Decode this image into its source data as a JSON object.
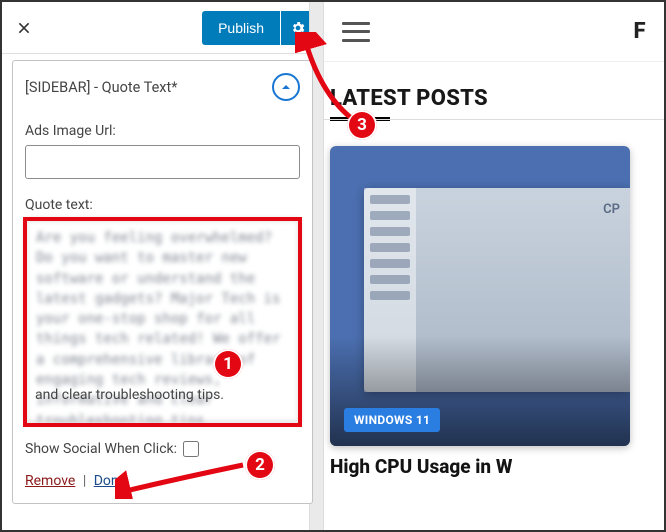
{
  "topbar": {
    "publish_label": "Publish"
  },
  "widget": {
    "title": "[SIDEBAR] - Quote Text*",
    "ads_url_label": "Ads Image Url:",
    "ads_url_value": "",
    "quote_label": "Quote text:",
    "quote_value": "Are you feeling overwhelmed? Do you want to master new software or understand the latest gadgets? Major Tech is your one-stop shop for all things tech related! We offer a comprehensive library of engaging tech reviews, informative and clear troubleshooting tips.",
    "quote_clear_line": "and clear troubleshooting tips.",
    "show_social_label": "Show Social When Click:",
    "remove_label": "Remove",
    "done_label": "Done"
  },
  "site": {
    "logo_fragment": "F",
    "latest_heading": "LATEST POSTS",
    "post_tag": "WINDOWS 11",
    "post_title": "High CPU Usage in W",
    "thumb_cpu_label": "CP"
  },
  "annotations": {
    "b1": "1",
    "b2": "2",
    "b3": "3"
  }
}
